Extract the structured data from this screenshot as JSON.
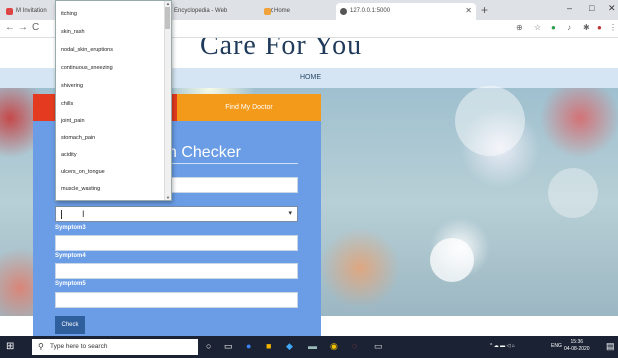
{
  "browser": {
    "tabs": [
      {
        "label": "M Invitation",
        "active": false
      },
      {
        "label": "Encyclopedia - Web",
        "active": false
      },
      {
        "label": "Home",
        "active": false
      },
      {
        "label": "127.0.0.1:5000",
        "active": true
      }
    ],
    "new_tab": "+",
    "window_controls": {
      "minimize": "–",
      "maximize": "□",
      "close": "✕"
    },
    "nav": {
      "back": "←",
      "forward": "→",
      "reload": "C"
    }
  },
  "site": {
    "title": "Care For You",
    "nav_home": "HOME"
  },
  "panel": {
    "tab_left_label": "",
    "tab_right_label": "Find My Doctor",
    "heading": "n Checker",
    "fields": [
      {
        "label": "Symptom3",
        "value": ""
      },
      {
        "label": "Symptom4",
        "value": ""
      },
      {
        "label": "Symptom5",
        "value": ""
      }
    ],
    "check_button": "Check",
    "select_arrow": "▾"
  },
  "dropdown": {
    "options": [
      "itching",
      "skin_rash",
      "nodal_skin_eruptions",
      "continuous_sneezing",
      "shivering",
      "chills",
      "joint_pain",
      "stomach_pain",
      "acidity",
      "ulcers_on_tongue",
      "muscle_wasting"
    ]
  },
  "taskbar": {
    "search_placeholder": "Type here to search",
    "lang": "ENG",
    "time": "15:36",
    "date": "04-08-2020"
  },
  "colors": {
    "panel": "#6a9de6",
    "tab_red": "#e43a1f",
    "tab_orange": "#f49a1b",
    "check_button": "#2f5f9d"
  }
}
